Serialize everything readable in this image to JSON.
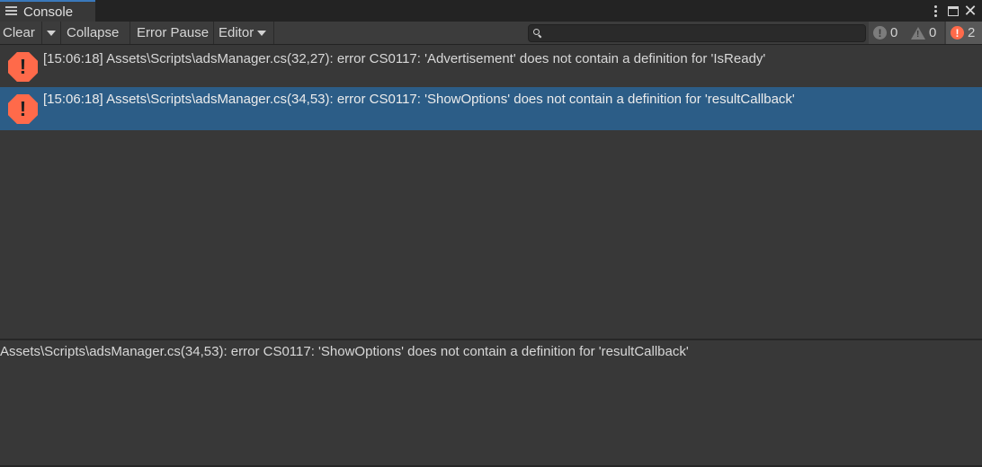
{
  "tab": {
    "title": "Console",
    "icon": "console-list-icon"
  },
  "window_controls": {
    "menu_icon": "kebab-menu-icon",
    "maximize_icon": "maximize-icon",
    "close_icon": "close-icon",
    "close_glyph": "✕"
  },
  "toolbar": {
    "clear_label": "Clear",
    "collapse_label": "Collapse",
    "error_pause_label": "Error Pause",
    "editor_label": "Editor"
  },
  "search": {
    "value": "",
    "placeholder": "",
    "icon": "search-icon"
  },
  "counters": {
    "log_count": "0",
    "warning_count": "0",
    "error_count": "2",
    "log_glyph": "!",
    "warning_glyph": "!",
    "error_glyph": "!"
  },
  "logs": [
    {
      "icon": "error-icon",
      "glyph": "!",
      "message": "[15:06:18] Assets\\Scripts\\adsManager.cs(32,27): error CS0117: 'Advertisement' does not contain a definition for 'IsReady'",
      "selected": false
    },
    {
      "icon": "error-icon",
      "glyph": "!",
      "message": "[15:06:18] Assets\\Scripts\\adsManager.cs(34,53): error CS0117: 'ShowOptions' does not contain a definition for 'resultCallback'",
      "selected": true
    }
  ],
  "detail": {
    "text": "Assets\\Scripts\\adsManager.cs(34,53): error CS0117: 'ShowOptions' does not contain a definition for 'resultCallback'"
  },
  "colors": {
    "background": "#383838",
    "tab_accent": "#3a79bb",
    "selected_row": "#2c5d87",
    "error": "#ff6a4a"
  }
}
